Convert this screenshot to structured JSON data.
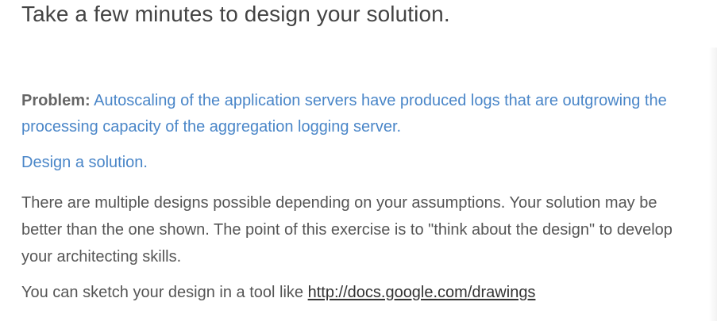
{
  "slide": {
    "title": "Take a few minutes to design your solution.",
    "problem": {
      "label": "Problem:",
      "text": "Autoscaling of the application servers have produced logs that are outgrowing the processing capacity of the aggregation logging server."
    },
    "design_prompt": "Design a solution.",
    "explanation": "There are multiple designs possible depending on your assumptions. Your solution may be better than the one shown. The point of this exercise is to \"think about the design\" to develop your architecting skills.",
    "sketch": {
      "prefix": "You can sketch your design in a tool like",
      "link_text": "http://docs.google.com/drawings"
    }
  }
}
